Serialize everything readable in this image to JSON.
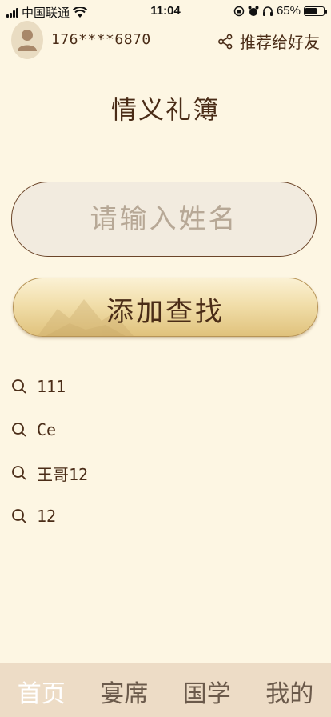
{
  "status_bar": {
    "carrier": "中国联通",
    "time": "11:04",
    "battery": "65%",
    "battery_level": 0.65
  },
  "header": {
    "phone": "176****6870",
    "share_label": "推荐给好友",
    "share_icon": "share-icon",
    "avatar_icon": "user-avatar-icon"
  },
  "title": "情义礼簿",
  "search": {
    "placeholder": "请输入姓名",
    "value": ""
  },
  "add_button_label": "添加查找",
  "history": [
    {
      "text": "111"
    },
    {
      "text": "Ce"
    },
    {
      "text": "王哥12"
    },
    {
      "text": "12"
    }
  ],
  "tabs": [
    {
      "label": "首页",
      "active": true
    },
    {
      "label": "宴席",
      "active": false
    },
    {
      "label": "国学",
      "active": false
    },
    {
      "label": "我的",
      "active": false
    }
  ],
  "colors": {
    "background": "#fdf6e3",
    "text": "#4a2c17",
    "tabbar": "#eddcc6",
    "button_gold": "#e0c27c"
  }
}
